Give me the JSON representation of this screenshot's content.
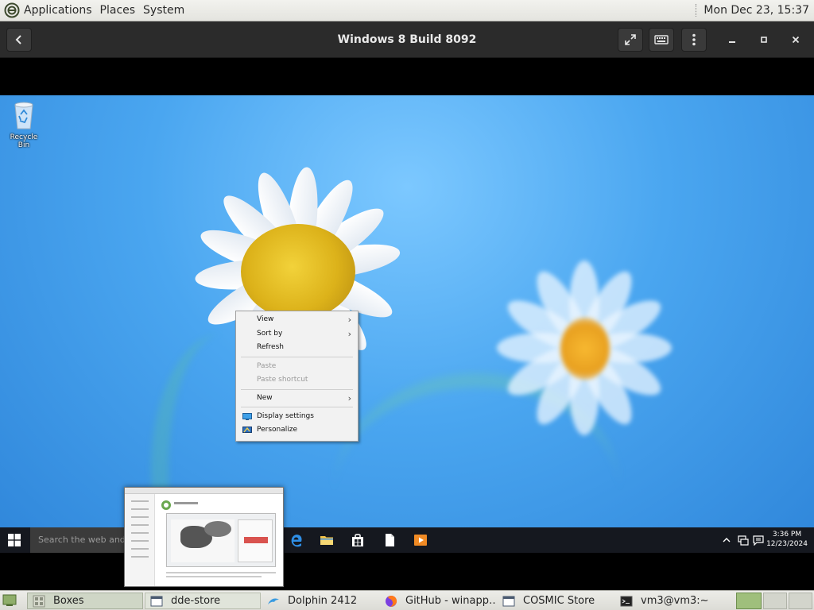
{
  "top_panel": {
    "menus": [
      "Applications",
      "Places",
      "System"
    ],
    "clock": "Mon Dec 23, 15:37"
  },
  "boxes": {
    "title": "Windows 8 Build 8092"
  },
  "windows_vm": {
    "desktop_icons": [
      {
        "label": "Recycle Bin",
        "icon": "recycle-bin-icon"
      }
    ],
    "context_menu": [
      {
        "label": "View",
        "submenu": true,
        "disabled": false
      },
      {
        "label": "Sort by",
        "submenu": true,
        "disabled": false
      },
      {
        "label": "Refresh",
        "submenu": false,
        "disabled": false
      },
      {
        "label": "Paste",
        "submenu": false,
        "disabled": true
      },
      {
        "label": "Paste shortcut",
        "submenu": false,
        "disabled": true
      },
      {
        "label": "New",
        "submenu": true,
        "disabled": false
      },
      {
        "label": "Display settings",
        "submenu": false,
        "disabled": false,
        "icon": "display-icon"
      },
      {
        "label": "Personalize",
        "submenu": false,
        "disabled": false,
        "icon": "personalize-icon"
      }
    ],
    "taskbar": {
      "search_placeholder": "Search the web and",
      "clock_time": "3:36 PM",
      "clock_date": "12/23/2024",
      "pinned": [
        "edge-icon",
        "file-explorer-icon",
        "store-icon",
        "document-icon",
        "media-player-icon"
      ]
    }
  },
  "bottom_panel": {
    "tasks": [
      {
        "label": "Boxes",
        "icon": "boxes-icon",
        "active": true
      },
      {
        "label": "dde-store",
        "icon": "window-icon",
        "active": false
      },
      {
        "label": "Dolphin 2412",
        "icon": "dolphin-icon",
        "active": false
      },
      {
        "label": "GitHub - winapp…",
        "icon": "firefox-icon",
        "active": false
      },
      {
        "label": "COSMIC Store",
        "icon": "window-icon",
        "active": false
      },
      {
        "label": "vm3@vm3:~",
        "icon": "terminal-icon",
        "active": false
      }
    ]
  },
  "colors": {
    "desktop_sky": "#3a95e4",
    "taskbar": "#15181f",
    "header_bar": "#2b2b2b"
  }
}
